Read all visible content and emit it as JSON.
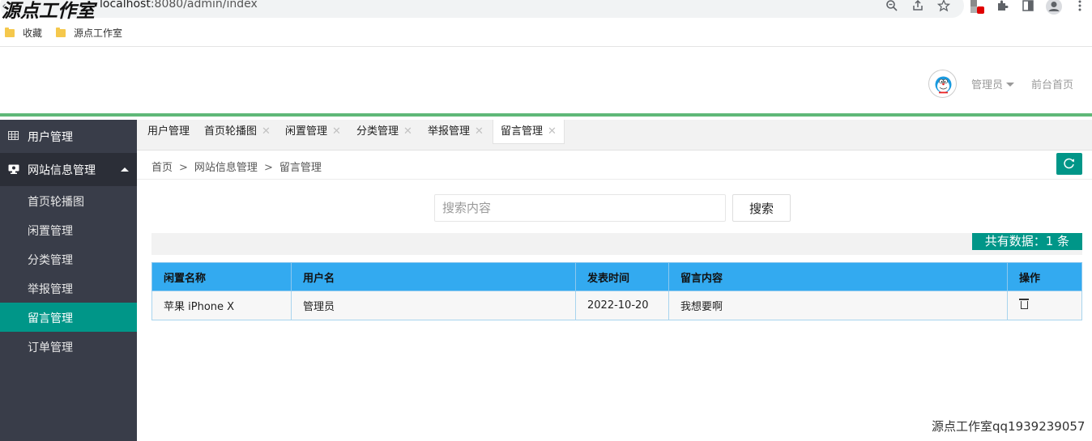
{
  "browser": {
    "watermark_top": "源点工作室",
    "url_host": "localhost",
    "url_rest": ":8080/admin/index",
    "bookmarks": [
      {
        "label": "收藏"
      },
      {
        "label": "源点工作室"
      }
    ]
  },
  "header": {
    "user_label": "管理员",
    "front_link": "前台首页"
  },
  "sidebar": {
    "user_mgmt": "用户管理",
    "site_info": "网站信息管理",
    "items": [
      "首页轮播图",
      "闲置管理",
      "分类管理",
      "举报管理",
      "留言管理",
      "订单管理"
    ],
    "active_item": "留言管理"
  },
  "tabs": [
    {
      "label": "用户管理",
      "closable": false
    },
    {
      "label": "首页轮播图",
      "closable": true
    },
    {
      "label": "闲置管理",
      "closable": true
    },
    {
      "label": "分类管理",
      "closable": true
    },
    {
      "label": "举报管理",
      "closable": true
    },
    {
      "label": "留言管理",
      "closable": true,
      "active": true
    }
  ],
  "breadcrumb": {
    "sep": ">",
    "items": [
      "首页",
      "网站信息管理",
      "留言管理"
    ]
  },
  "search": {
    "placeholder": "搜索内容",
    "button_label": "搜索"
  },
  "count_label": "共有数据：1 条",
  "table": {
    "headers": [
      "闲置名称",
      "用户名",
      "发表时间",
      "留言内容",
      "操作"
    ],
    "rows": [
      [
        "苹果 iPhone X",
        "管理员",
        "2022-10-20",
        "我想要啊"
      ]
    ]
  },
  "watermark_bottom": "源点工作室qq1939239057",
  "colors": {
    "accent": "#009688",
    "header_line": "#5fb878",
    "sidebar_bg": "#393d49",
    "table_header": "#33aaf0"
  },
  "icons": [
    "back-icon",
    "forward-icon",
    "info-icon",
    "zoom-icon",
    "share-icon",
    "star-icon",
    "extension-icon",
    "puzzle-icon",
    "sidepanel-icon",
    "profile-icon",
    "menu-icon",
    "grid-icon",
    "monitor-icon",
    "refresh-icon",
    "trash-icon"
  ]
}
